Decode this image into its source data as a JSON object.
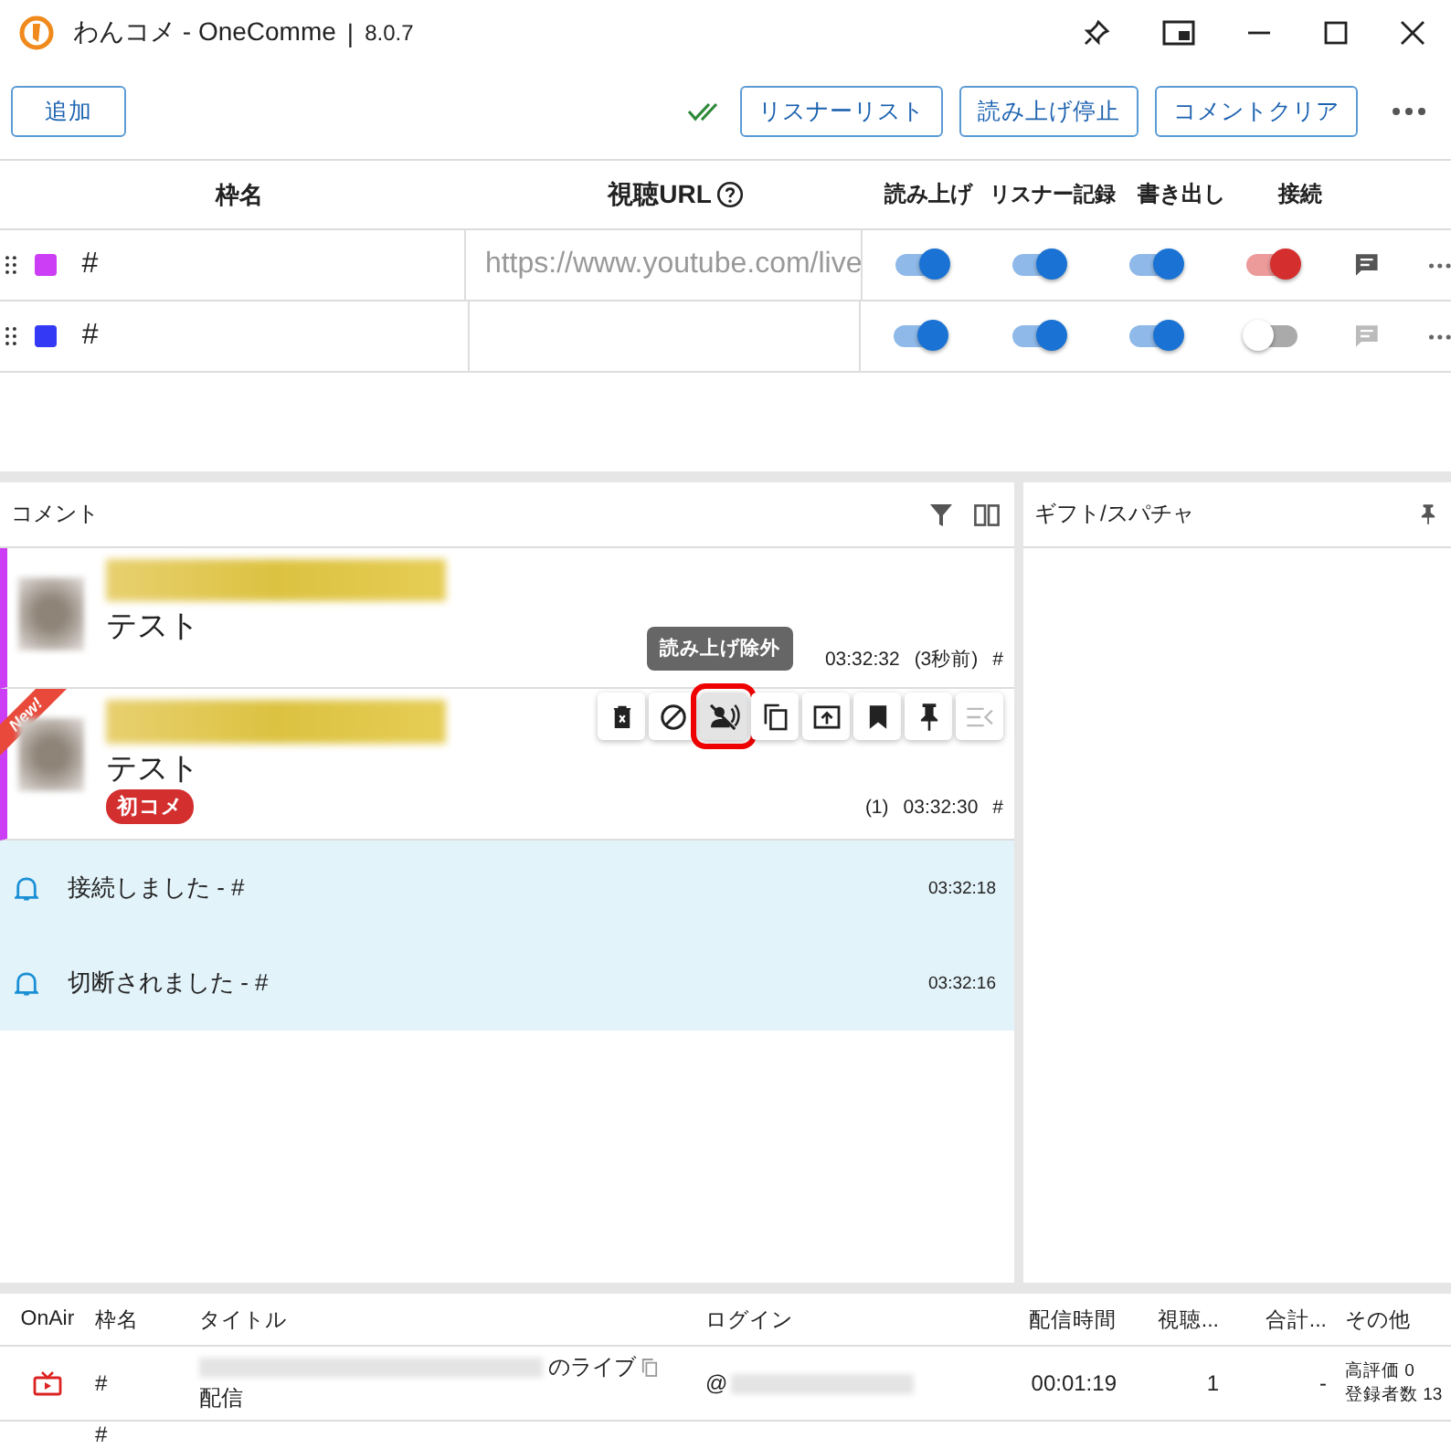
{
  "window": {
    "title": "わんコメ - OneComme",
    "separator": "|",
    "version": "8.0.7"
  },
  "toolbar": {
    "add": "追加",
    "buttons": [
      "リスナーリスト",
      "読み上げ停止",
      "コメントクリア"
    ]
  },
  "frames": {
    "columns": [
      "枠名",
      "視聴URL",
      "読み上げ",
      "リスナー記録",
      "書き出し",
      "接続"
    ],
    "rows": [
      {
        "color": "#cc3ef5",
        "name": "#",
        "url": "https://www.youtube.com/live",
        "read": true,
        "record": true,
        "export": true,
        "connected": true
      },
      {
        "color": "#3339f5",
        "name": "#",
        "url": "",
        "read": true,
        "record": true,
        "export": true,
        "connected": false
      }
    ]
  },
  "comments": {
    "title": "コメント",
    "items": [
      {
        "text": "テスト",
        "time": "03:32:32",
        "ago": "(3秒前)",
        "frame": "#",
        "new": false,
        "hovered": false
      },
      {
        "text": "テスト",
        "count": "(1)",
        "time": "03:32:30",
        "frame": "#",
        "new": true,
        "new_label": "New!",
        "badge": "初コメ",
        "hovered": true
      }
    ],
    "tooltip": "読み上げ除外",
    "actions": [
      {
        "kind": "delete",
        "selected": false
      },
      {
        "kind": "block",
        "selected": false
      },
      {
        "kind": "mute",
        "selected": true
      },
      {
        "kind": "copy",
        "selected": false
      },
      {
        "kind": "open",
        "selected": false
      },
      {
        "kind": "bookmark",
        "selected": false
      },
      {
        "kind": "pin",
        "selected": false
      },
      {
        "kind": "collapse",
        "selected": false
      }
    ],
    "notices": [
      {
        "text": "接続しました - #",
        "time": "03:32:18"
      },
      {
        "text": "切断されました - #",
        "time": "03:32:16"
      }
    ]
  },
  "gifts": {
    "title": "ギフト/スパチャ"
  },
  "streams": {
    "columns": [
      "OnAir",
      "枠名",
      "タイトル",
      "ログイン",
      "配信時間",
      "視聴...",
      "合計...",
      "その他"
    ],
    "rows": [
      {
        "frame": "#",
        "title_suffix": "のライブ",
        "title_line2": "配信",
        "login": "@",
        "duration": "00:01:19",
        "viewers": "1",
        "total": "-",
        "other": [
          "高評価 0",
          "登録者数 13"
        ]
      }
    ],
    "next_frame": "#"
  }
}
